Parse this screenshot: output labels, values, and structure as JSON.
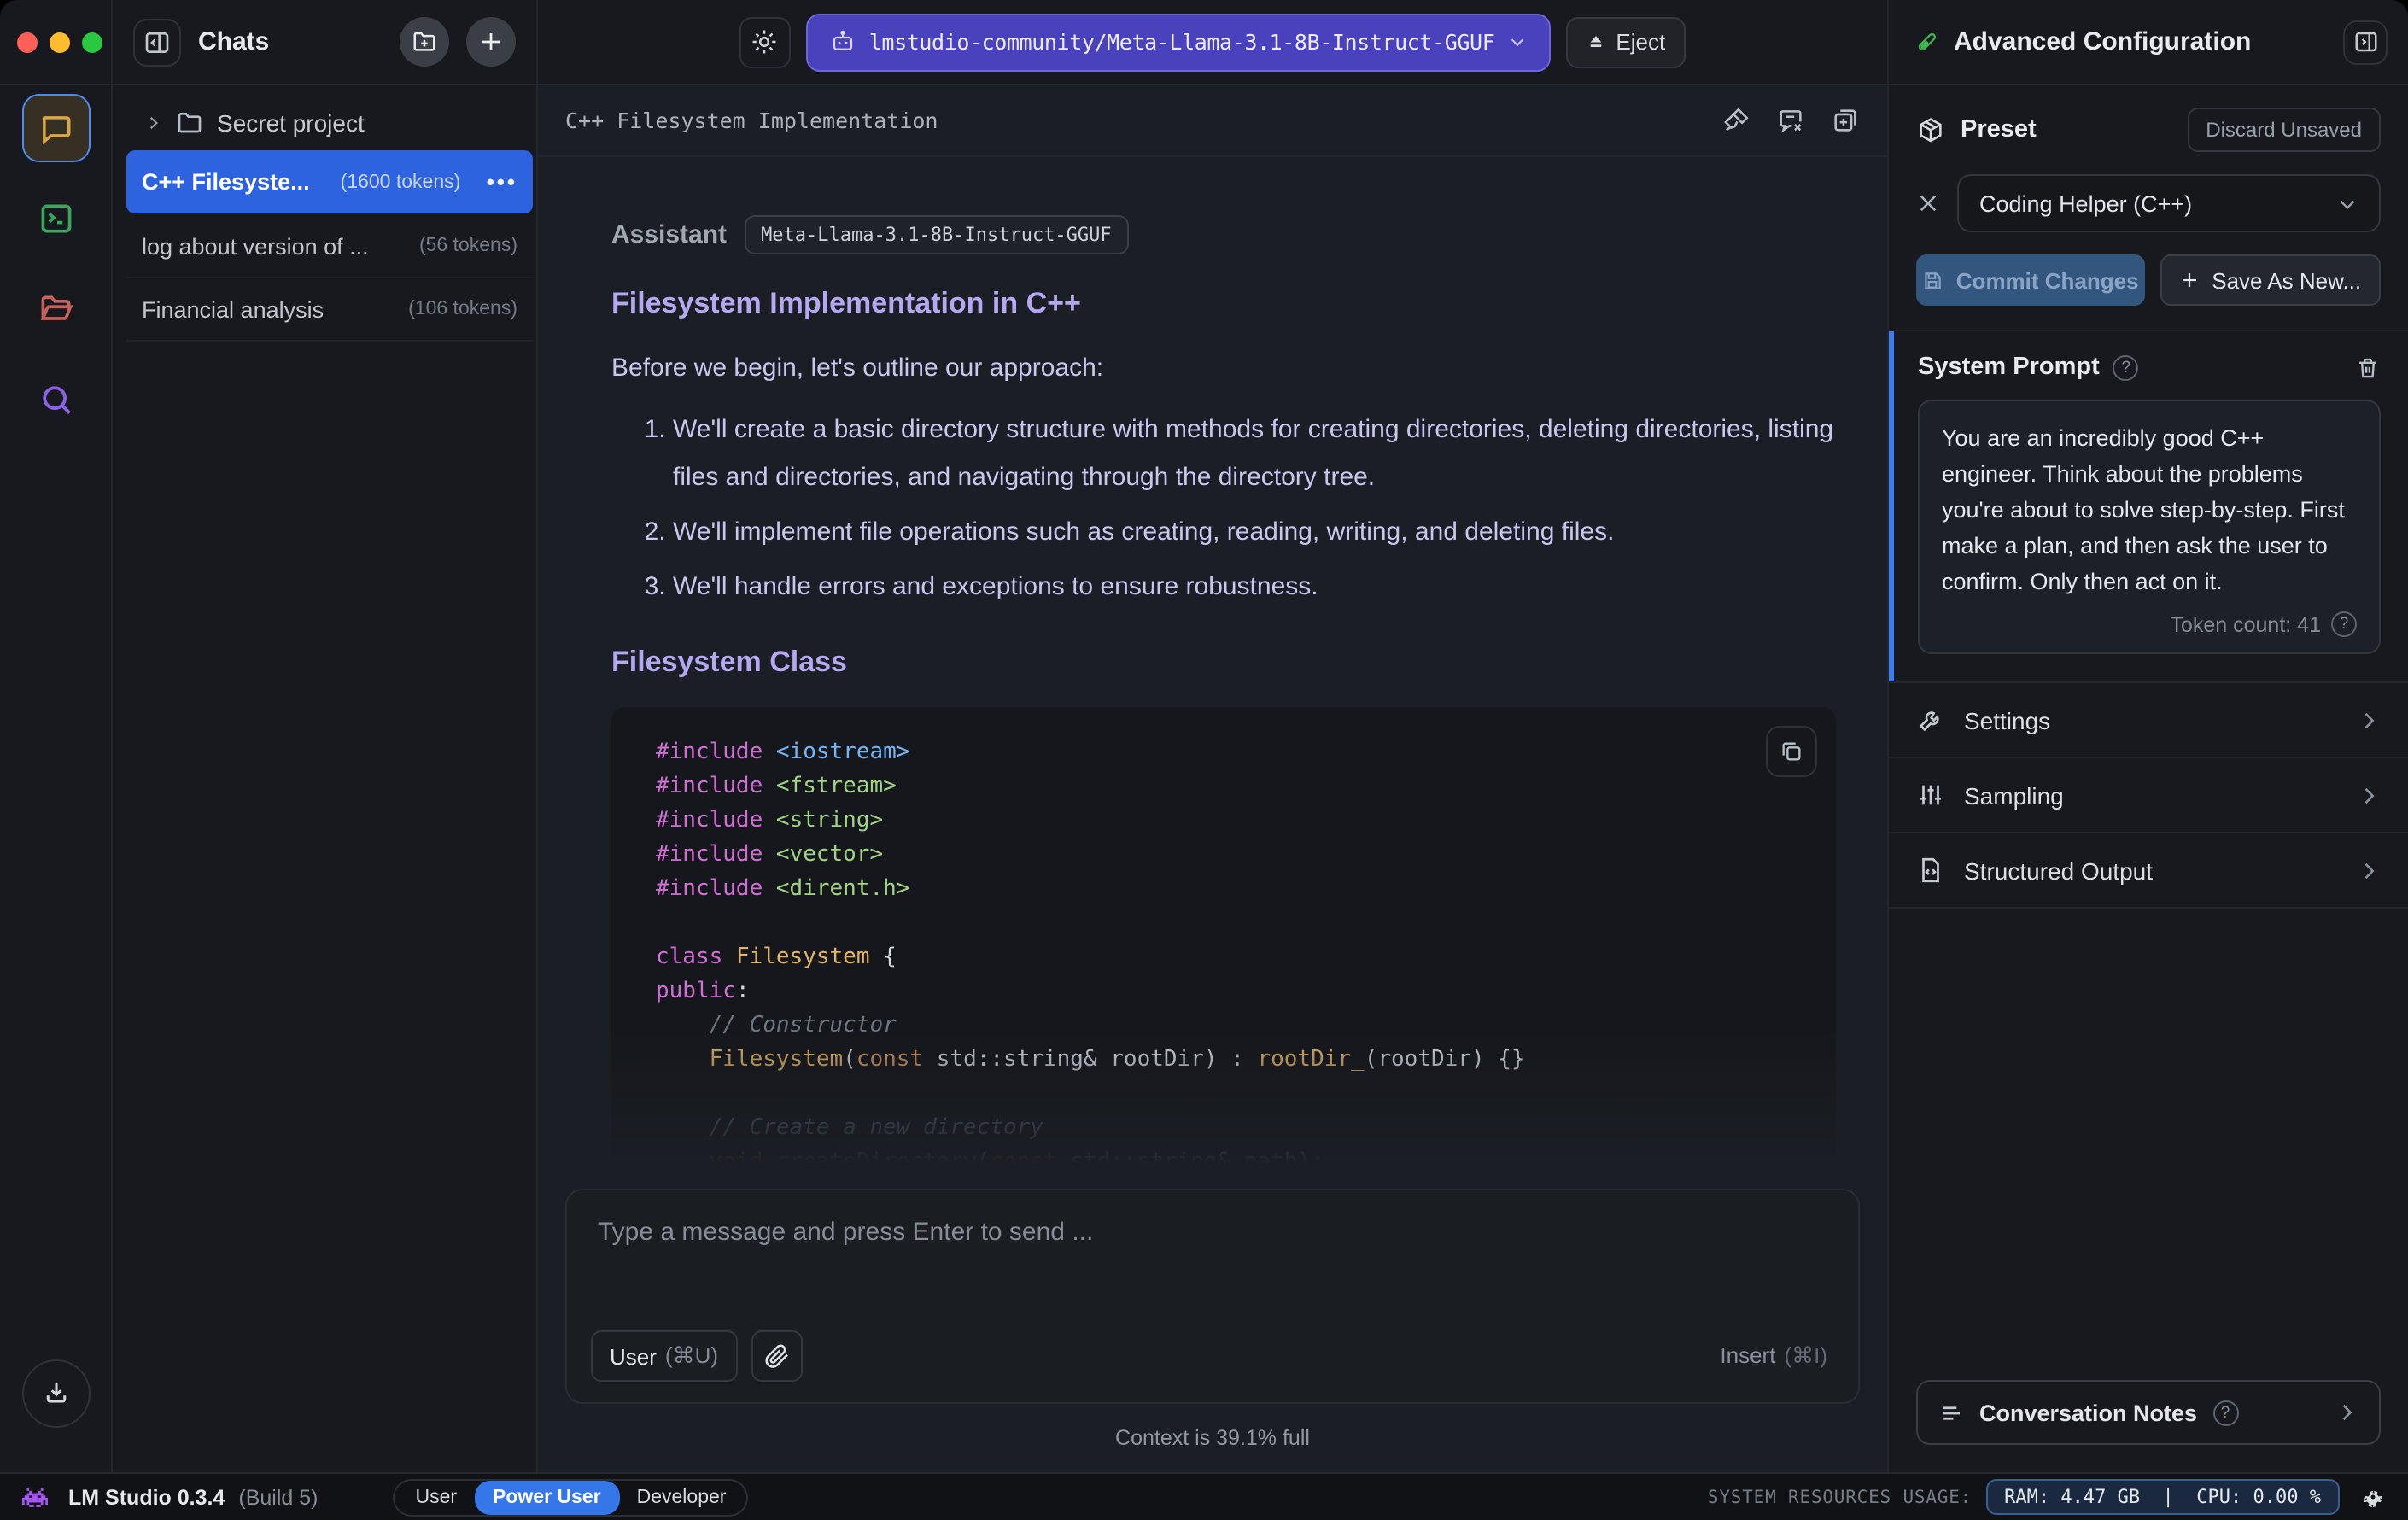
{
  "topbar": {
    "chats_title": "Chats",
    "model_name": "lmstudio-community/Meta-Llama-3.1-8B-Instruct-GGUF",
    "eject_label": "Eject",
    "panel_title": "Advanced Configuration"
  },
  "chat_list": {
    "folder_name": "Secret project",
    "selected_dots": "•••",
    "items": [
      {
        "title": "C++ Filesyste...",
        "tokens": "(1600 tokens)"
      },
      {
        "title": "log about version of ...",
        "tokens": "(56 tokens)"
      },
      {
        "title": "Financial analysis",
        "tokens": "(106 tokens)"
      }
    ]
  },
  "chat": {
    "title": "C++ Filesystem Implementation",
    "assistant_label": "Assistant",
    "model_badge": "Meta-Llama-3.1-8B-Instruct-GGUF",
    "heading1": "Filesystem Implementation in C++",
    "intro": "Before we begin, let's outline our approach:",
    "list": [
      "We'll create a basic directory structure with methods for creating directories, deleting directories, listing files and directories, and navigating through the directory tree.",
      "We'll implement file operations such as creating, reading, writing, and deleting files.",
      "We'll handle errors and exceptions to ensure robustness."
    ],
    "heading2": "Filesystem Class",
    "code_lines": [
      [
        [
          "pp",
          "#include"
        ],
        [
          "pl",
          " "
        ],
        [
          "inc",
          "<iostream>"
        ]
      ],
      [
        [
          "pp",
          "#include"
        ],
        [
          "pl",
          " "
        ],
        [
          "str",
          "<fstream>"
        ]
      ],
      [
        [
          "pp",
          "#include"
        ],
        [
          "pl",
          " "
        ],
        [
          "str",
          "<string>"
        ]
      ],
      [
        [
          "pp",
          "#include"
        ],
        [
          "pl",
          " "
        ],
        [
          "str",
          "<vector>"
        ]
      ],
      [
        [
          "pp",
          "#include"
        ],
        [
          "pl",
          " "
        ],
        [
          "str",
          "<dirent.h>"
        ]
      ],
      [],
      [
        [
          "kw",
          "class"
        ],
        [
          "pl",
          " "
        ],
        [
          "type",
          "Filesystem"
        ],
        [
          "pl",
          " {"
        ]
      ],
      [
        [
          "kw",
          "public"
        ],
        [
          "pl",
          ":"
        ]
      ],
      [
        [
          "pl",
          "    "
        ],
        [
          "cmt",
          "// Constructor"
        ]
      ],
      [
        [
          "pl",
          "    "
        ],
        [
          "type",
          "Filesystem"
        ],
        [
          "pl",
          "("
        ],
        [
          "kw2",
          "const"
        ],
        [
          "pl",
          " std::string& rootDir) : "
        ],
        [
          "type",
          "rootDir_"
        ],
        [
          "pl",
          "(rootDir) {}"
        ]
      ],
      [],
      [
        [
          "pl",
          "    "
        ],
        [
          "cmt",
          "// Create a new directory"
        ]
      ],
      [
        [
          "pl",
          "    "
        ],
        [
          "kw2",
          "void"
        ],
        [
          "pl",
          " "
        ],
        [
          "fn",
          "createDirectory"
        ],
        [
          "pl",
          "("
        ],
        [
          "kw2",
          "const"
        ],
        [
          "pl",
          " std::string& path);"
        ]
      ]
    ]
  },
  "composer": {
    "placeholder": "Type a message and press Enter to send ...",
    "role_label": "User",
    "role_shortcut": "(⌘U)",
    "insert_label": "Insert",
    "insert_shortcut": "(⌘I)",
    "context_status": "Context is 39.1% full"
  },
  "config_panel": {
    "help_glyph": "?",
    "preset": {
      "label": "Preset",
      "discard_label": "Discard Unsaved",
      "value": "Coding Helper (C++)",
      "commit_label": "Commit Changes",
      "save_as_new_label": "Save As New..."
    },
    "system_prompt": {
      "label": "System Prompt",
      "text": "You are an incredibly good C++ engineer. Think about the problems you're about to solve step-by-step. First make a plan, and then ask the user to confirm. Only then act on it.",
      "token_count": "Token count: 41"
    },
    "sections": [
      {
        "label": "Settings"
      },
      {
        "label": "Sampling"
      },
      {
        "label": "Structured Output"
      }
    ],
    "notes_label": "Conversation Notes"
  },
  "statusbar": {
    "app_name": "LM Studio 0.3.4",
    "build": "(Build 5)",
    "modes": [
      "User",
      "Power User",
      "Developer"
    ],
    "resources_label": "SYSTEM RESOURCES USAGE:",
    "resources_value": "RAM: 4.47 GB  |  CPU: 0.00 %"
  },
  "colors": {
    "selection_blue": "#2e63e0",
    "accent_purple": "#4a42bd",
    "mode_chip_blue": "#3577e8",
    "system_prompt_accent": "#3b7ef2"
  }
}
